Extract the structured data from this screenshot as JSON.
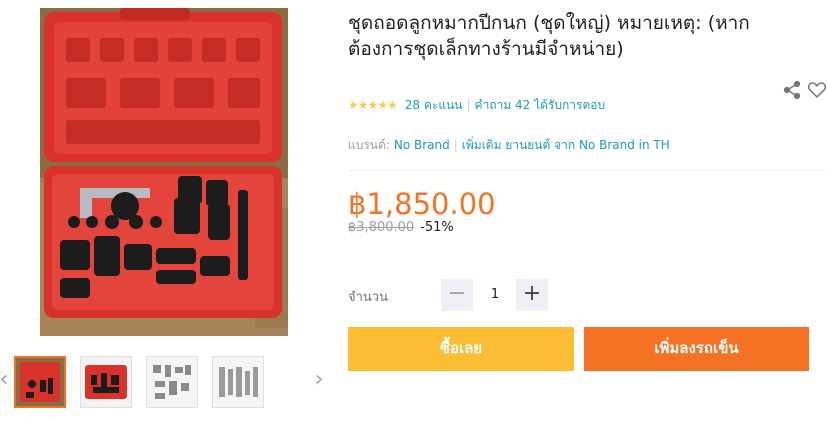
{
  "product": {
    "title": "ชุดถอดลูกหมากปีกนก (ชุดใหญ่) หมายเหตุ: (หากต้องการชุดเล็กทางร้านมีจำหน่าย)",
    "rating": {
      "stars": "★★★★★",
      "ratings_text": "28 คะแนน",
      "questions_text": "คำถาม 42 ได้รับการตอบ"
    },
    "brand": {
      "label": "แบรนด์:",
      "name": "No Brand",
      "more_text": "เพิ่มเติม ยานยนต์ จาก No Brand in TH"
    },
    "price": "฿1,850.00",
    "original_price": "฿3,800.00",
    "discount": "-51%"
  },
  "quantity": {
    "label": "จำนวน",
    "value": "1",
    "minus": "−",
    "plus": "+"
  },
  "buttons": {
    "buy_now": "ซื้อเลย",
    "add_to_cart": "เพิ่มลงรถเข็น"
  },
  "gallery": {
    "prev": "‹",
    "next": "›",
    "thumbnail_count": 4,
    "active_index": 0
  },
  "icons": {
    "share": "share-icon",
    "wishlist": "heart-icon"
  },
  "colors": {
    "accent": "#f57224",
    "buy_button": "#fcbd34",
    "link": "#1a9cb7",
    "star": "#faca51",
    "case_red": "#d9322b"
  }
}
